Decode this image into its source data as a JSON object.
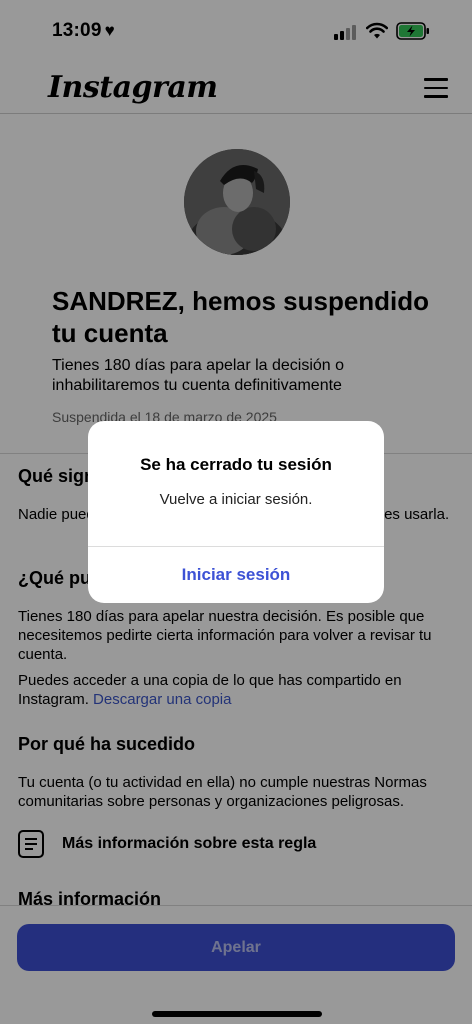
{
  "status_bar": {
    "time": "13:09",
    "heart": "♥"
  },
  "header": {
    "logo": "Instagram",
    "menu_icon": "hamburger-menu-icon"
  },
  "profile": {
    "avatar_icon": "profile-avatar"
  },
  "notice": {
    "title": "SANDREZ, hemos suspendido tu cuenta",
    "subtitle": "Tienes 180 días para apelar la decisión o inhabilitaremos tu cuenta definitivamente",
    "date": "Suspendida el 18 de marzo de 2025"
  },
  "sections": {
    "meaning_heading": "Qué significa",
    "meaning_body": "Nadie puede ver tu cuenta en este momento y no puedes usarla.",
    "what_heading": "¿Qué puedes hacer?",
    "what_body": "Tienes 180 días para apelar nuestra decisión. Es posible que necesitemos pedirte cierta información para volver a revisar tu cuenta.",
    "copy_body": "Puedes acceder a una copia de lo que has compartido en Instagram.",
    "copy_link": "Descargar una copia",
    "why_heading": "Por qué ha sucedido",
    "why_body": "Tu cuenta (o tu actividad en ella) no cumple nuestras Normas comunitarias sobre personas y organizaciones peligrosas.",
    "rule_label": "Más información sobre esta regla",
    "rule_icon": "document-icon",
    "more_heading": "Más información"
  },
  "footer": {
    "appeal_label": "Apelar"
  },
  "dialog": {
    "title": "Se ha cerrado tu sesión",
    "body": "Vuelve a iniciar sesión.",
    "button": "Iniciar sesión"
  },
  "colors": {
    "accent": "#3d4fd2",
    "link": "#3b56c8",
    "battery_charge": "#34c759"
  }
}
